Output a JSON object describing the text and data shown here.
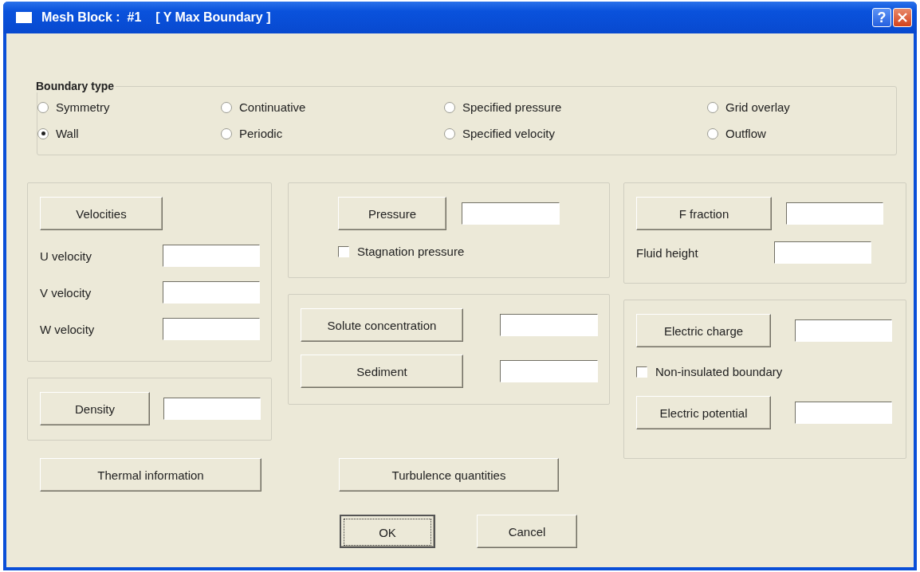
{
  "window": {
    "title": "Mesh Block :  #1    [ Y Max Boundary ]",
    "help": "?"
  },
  "boundary_type": {
    "label": "Boundary type",
    "options": [
      {
        "label": "Symmetry",
        "selected": false
      },
      {
        "label": "Continuative",
        "selected": false
      },
      {
        "label": "Specified pressure",
        "selected": false
      },
      {
        "label": "Grid overlay",
        "selected": false
      },
      {
        "label": "Wall",
        "selected": true
      },
      {
        "label": "Periodic",
        "selected": false
      },
      {
        "label": "Specified velocity",
        "selected": false
      },
      {
        "label": "Outflow",
        "selected": false
      }
    ]
  },
  "columns": [
    {
      "groups": [
        {
          "rows": [
            {
              "kind": "button",
              "button": "Velocities"
            },
            {
              "kind": "field",
              "label": "U velocity"
            },
            {
              "kind": "field",
              "label": "V velocity"
            },
            {
              "kind": "field",
              "label": "W velocity"
            }
          ]
        },
        {
          "rows": [
            {
              "kind": "button_field",
              "button": "Density"
            }
          ]
        }
      ],
      "bottom_button": "Thermal information"
    },
    {
      "groups": [
        {
          "rows": [
            {
              "kind": "button_field",
              "button": "Pressure"
            },
            {
              "kind": "checkbox",
              "label": "Stagnation pressure",
              "checked": false
            }
          ]
        },
        {
          "rows": [
            {
              "kind": "button_field",
              "button": "Solute concentration"
            },
            {
              "kind": "button_field",
              "button": "Sediment"
            }
          ]
        }
      ],
      "bottom_button": "Turbulence quantities"
    },
    {
      "groups": [
        {
          "rows": [
            {
              "kind": "button_field",
              "button": "F fraction"
            },
            {
              "kind": "field",
              "label": "Fluid height"
            }
          ]
        },
        {
          "rows": [
            {
              "kind": "button_field",
              "button": "Electric charge"
            },
            {
              "kind": "checkbox",
              "label": "Non-insulated boundary",
              "checked": false
            },
            {
              "kind": "button_field",
              "button": "Electric potential"
            }
          ]
        }
      ]
    }
  ],
  "buttons": [
    {
      "label": "OK",
      "default": true
    },
    {
      "label": "Cancel",
      "default": false
    }
  ]
}
